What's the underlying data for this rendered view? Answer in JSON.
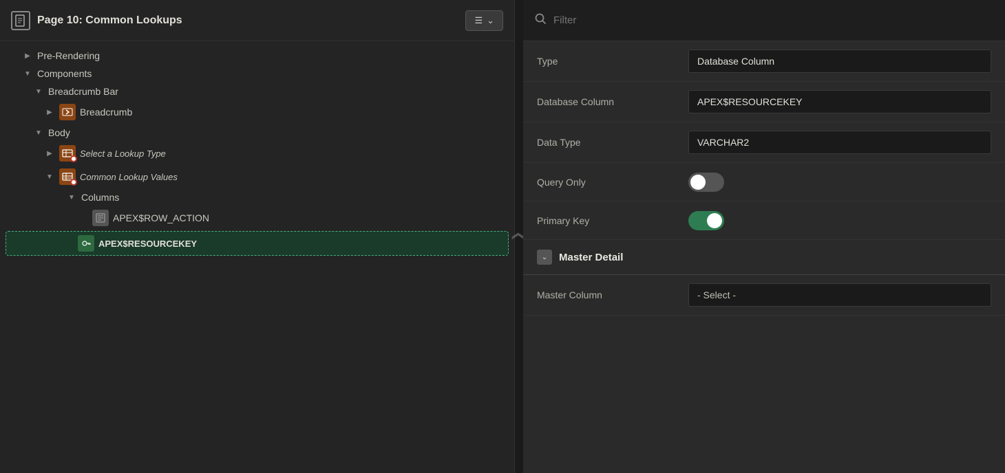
{
  "header": {
    "page_title": "Page 10: Common Lookups",
    "menu_label": "≡ ∨",
    "page_icon": "📄"
  },
  "tree": {
    "items": [
      {
        "id": "pre-rendering",
        "label": "Pre-Rendering",
        "indent": "indent-1",
        "chevron": "right",
        "icon": null
      },
      {
        "id": "components",
        "label": "Components",
        "indent": "indent-1",
        "chevron": "down",
        "icon": null
      },
      {
        "id": "breadcrumb-bar",
        "label": "Breadcrumb Bar",
        "indent": "indent-2",
        "chevron": "down",
        "icon": null
      },
      {
        "id": "breadcrumb",
        "label": "Breadcrumb",
        "indent": "indent-3",
        "chevron": "right",
        "icon": "breadcrumb"
      },
      {
        "id": "body",
        "label": "Body",
        "indent": "indent-2",
        "chevron": "down",
        "icon": null
      },
      {
        "id": "select-lookup",
        "label": "Select a Lookup Type",
        "indent": "indent-3",
        "chevron": "right",
        "icon": "grid",
        "italic": true,
        "dot": true
      },
      {
        "id": "common-lookup",
        "label": "Common Lookup Values",
        "indent": "indent-3",
        "chevron": "down",
        "icon": "grid-report",
        "italic": true,
        "dot": true
      },
      {
        "id": "columns",
        "label": "Columns",
        "indent": "indent-4",
        "chevron": "down",
        "icon": null
      },
      {
        "id": "row-action",
        "label": "APEX$ROW_ACTION",
        "indent": "indent-5",
        "chevron": null,
        "icon": "column"
      },
      {
        "id": "resourcekey",
        "label": "APEX$RESOURCEKEY",
        "indent": "indent-5",
        "chevron": null,
        "icon": "key",
        "selected": true
      }
    ]
  },
  "filter": {
    "placeholder": "Filter"
  },
  "properties": {
    "type_label": "Type",
    "type_value": "Database Column",
    "db_column_label": "Database Column",
    "db_column_value": "APEX$RESOURCEKEY",
    "data_type_label": "Data Type",
    "data_type_value": "VARCHAR2",
    "query_only_label": "Query Only",
    "query_only_on": false,
    "primary_key_label": "Primary Key",
    "primary_key_on": true
  },
  "master_detail": {
    "section_title": "Master Detail",
    "master_column_label": "Master Column",
    "master_column_value": "- Select -"
  },
  "icons": {
    "chevron_right": "▶",
    "chevron_down": "▼",
    "search": "🔍",
    "menu": "≡"
  }
}
